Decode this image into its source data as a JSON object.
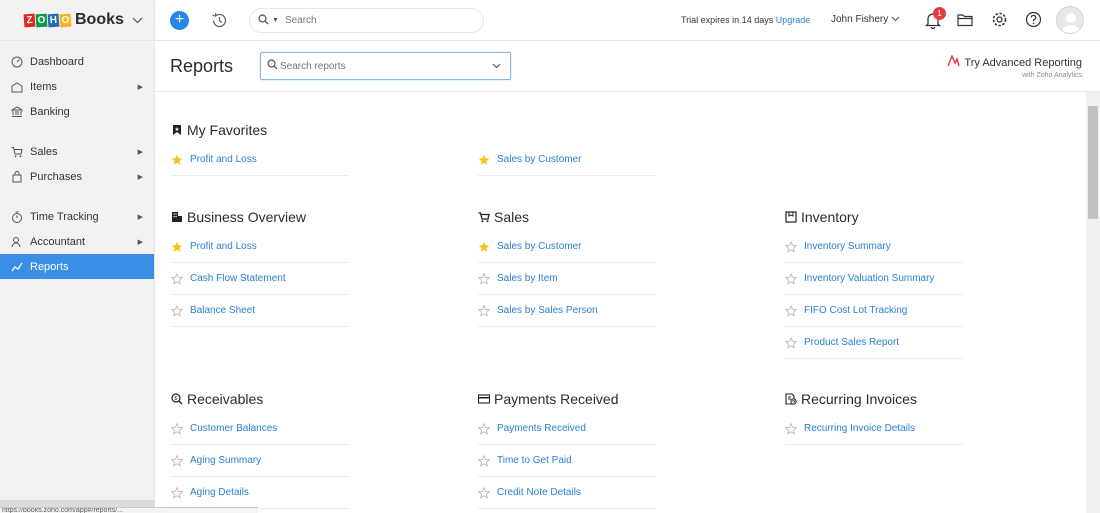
{
  "brand": {
    "logo_letters": [
      "Z",
      "O",
      "H",
      "O"
    ],
    "logo_colors": [
      "#e42527",
      "#089949",
      "#226db4",
      "#f9b21d"
    ],
    "name": "Books"
  },
  "sidebar": {
    "items": [
      {
        "label": "Dashboard",
        "icon": "dashboard-icon",
        "arrow": false,
        "active": false
      },
      {
        "label": "Items",
        "icon": "items-icon",
        "arrow": true,
        "active": false
      },
      {
        "label": "Banking",
        "icon": "bank-icon",
        "arrow": false,
        "active": false
      },
      {
        "label": "Sales",
        "icon": "cart-icon",
        "arrow": true,
        "active": false
      },
      {
        "label": "Purchases",
        "icon": "bag-icon",
        "arrow": true,
        "active": false
      },
      {
        "label": "Time Tracking",
        "icon": "timer-icon",
        "arrow": true,
        "active": false
      },
      {
        "label": "Accountant",
        "icon": "accountant-icon",
        "arrow": true,
        "active": false
      },
      {
        "label": "Reports",
        "icon": "reports-icon",
        "arrow": false,
        "active": true
      }
    ],
    "status_url": "https://books.zoho.com/app#/reports/..."
  },
  "topbar": {
    "search_placeholder": "Search",
    "trial_text": "Trial expires in 14 days",
    "upgrade_label": "Upgrade",
    "user_name": "John Fishery",
    "notification_count": "1"
  },
  "header": {
    "title": "Reports",
    "search_placeholder": "Search reports",
    "advanced_label": "Try Advanced Reporting",
    "advanced_sub": "with Zoho Analytics"
  },
  "colors": {
    "accent": "#2a7fd4",
    "active_nav": "#3a8ee6",
    "star_filled": "#f5c518",
    "star_empty": "#b9b9b9"
  },
  "sections": {
    "favorites": {
      "title": "My Favorites",
      "col1": [
        {
          "label": "Profit and Loss",
          "fav": true
        }
      ],
      "col2": [
        {
          "label": "Sales by Customer",
          "fav": true
        }
      ]
    },
    "business": {
      "title": "Business Overview",
      "items": [
        {
          "label": "Profit and Loss",
          "fav": true
        },
        {
          "label": "Cash Flow Statement",
          "fav": false
        },
        {
          "label": "Balance Sheet",
          "fav": false
        }
      ]
    },
    "sales": {
      "title": "Sales",
      "items": [
        {
          "label": "Sales by Customer",
          "fav": true
        },
        {
          "label": "Sales by Item",
          "fav": false
        },
        {
          "label": "Sales by Sales Person",
          "fav": false
        }
      ]
    },
    "inventory": {
      "title": "Inventory",
      "items": [
        {
          "label": "Inventory Summary",
          "fav": false
        },
        {
          "label": "Inventory Valuation Summary",
          "fav": false
        },
        {
          "label": "FIFO Cost Lot Tracking",
          "fav": false
        },
        {
          "label": "Product Sales Report",
          "fav": false
        }
      ]
    },
    "receivables": {
      "title": "Receivables",
      "items": [
        {
          "label": "Customer Balances",
          "fav": false
        },
        {
          "label": "Aging Summary",
          "fav": false
        },
        {
          "label": "Aging Details",
          "fav": false
        }
      ]
    },
    "payments": {
      "title": "Payments Received",
      "items": [
        {
          "label": "Payments Received",
          "fav": false
        },
        {
          "label": "Time to Get Paid",
          "fav": false
        },
        {
          "label": "Credit Note Details",
          "fav": false
        }
      ]
    },
    "recurring": {
      "title": "Recurring Invoices",
      "items": [
        {
          "label": "Recurring Invoice Details",
          "fav": false
        }
      ]
    }
  }
}
